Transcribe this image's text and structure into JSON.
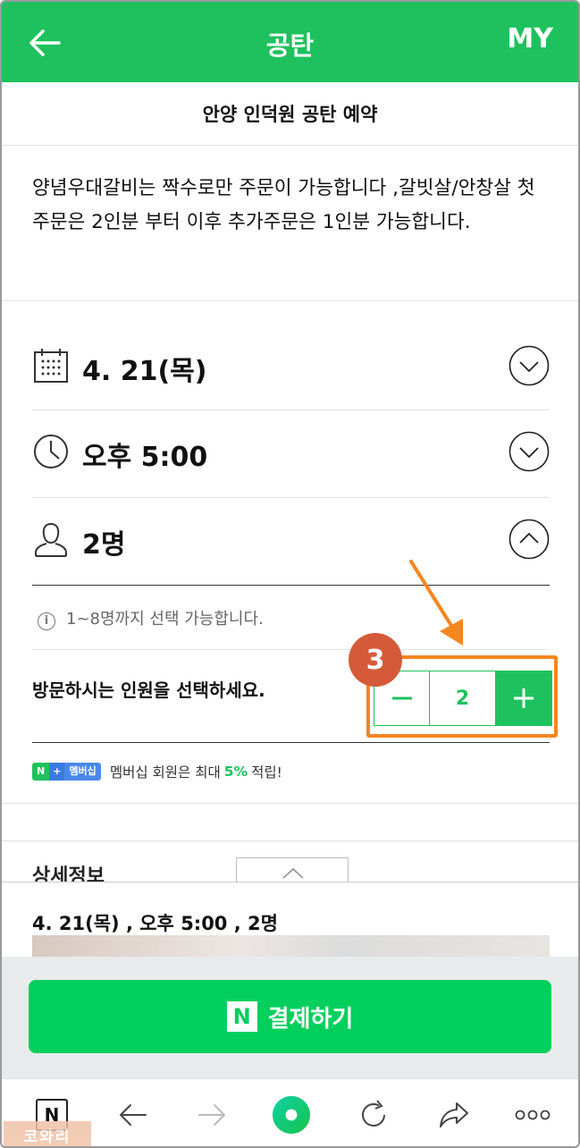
{
  "header": {
    "title": "공탄",
    "my_label": "MY"
  },
  "shop_title": "안양 인덕원 공탄 예약",
  "notice_text": "양념우대갈비는 짝수로만 주문이 가능합니다 ,갈빗살/안창살 첫주문은 2인분 부터 이후 추가주문은 1인분 가능합니다.",
  "selectors": {
    "date": "4. 21(목)",
    "time": "오후 5:00",
    "people": "2명"
  },
  "people_info": "1~8명까지 선택 가능합니다.",
  "visit_label": "방문하시는 인원을 선택하세요.",
  "stepper": {
    "value": "2"
  },
  "annotation_badge": "3",
  "membership": {
    "logo_a": "N",
    "logo_b": "+",
    "logo_c": "멤버십",
    "text_before": "멤버십 회원은 최대",
    "percent": "5%",
    "text_after": "적립!"
  },
  "detail_title": "상세정보",
  "summary": "4. 21(목) , 오후 5:00 , 2명",
  "pay_button": {
    "logo": "N",
    "label": "결제하기"
  },
  "browser_bar": {
    "home_logo": "N"
  },
  "watermark": "코와리",
  "colors": {
    "brand_green": "#1ec15d",
    "pay_green": "#03cf5d",
    "highlight_orange": "#f5861f",
    "badge_red": "#d55a3a"
  }
}
